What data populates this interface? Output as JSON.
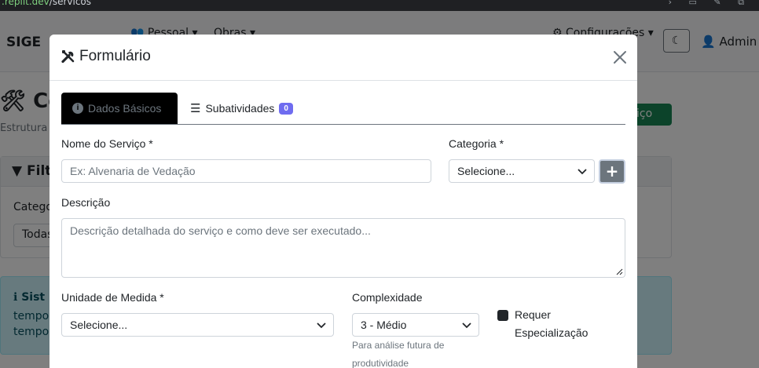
{
  "browser": {
    "url_host": ".replit.dev",
    "url_path": "/servicos"
  },
  "navbar": {
    "brand": "SIGE",
    "items": [
      "Pessoal",
      "Obras",
      "Configurações"
    ],
    "admin_label": "Admin"
  },
  "background": {
    "page_title": "Co",
    "page_subtitle": "Estrutura",
    "new_button": "rviço",
    "filter_title": "Filt",
    "filter_label": "Catego",
    "filter_select": "Todas",
    "info_title": "Sist",
    "info_line1": "tempo",
    "info_line2": "tempo"
  },
  "modal": {
    "title": "Formulário",
    "tabs": [
      {
        "label": "Dados Básicos"
      },
      {
        "label": "Subatividades",
        "badge": "0"
      }
    ],
    "nome_label": "Nome do Serviço *",
    "nome_placeholder": "Ex: Alvenaria de Vedação",
    "categoria_label": "Categoria *",
    "categoria_value": "Selecione...",
    "add_category_label": "+",
    "descricao_label": "Descrição",
    "descricao_placeholder": "Descrição detalhada do serviço e como deve ser executado...",
    "unidade_label": "Unidade de Medida *",
    "unidade_value": "Selecione...",
    "complexidade_label": "Complexidade",
    "complexidade_value": "3 - Médio",
    "complexidade_hint_1": "Para análise futura de",
    "complexidade_hint_2": "produtividade",
    "especializacao_label_1": "Requer",
    "especializacao_label_2": "Especialização"
  },
  "colors": {
    "backdrop": "#000000",
    "active_tab_bg": "#000000",
    "badge": "#6f6cf0",
    "plus_button": "#6c757d"
  }
}
